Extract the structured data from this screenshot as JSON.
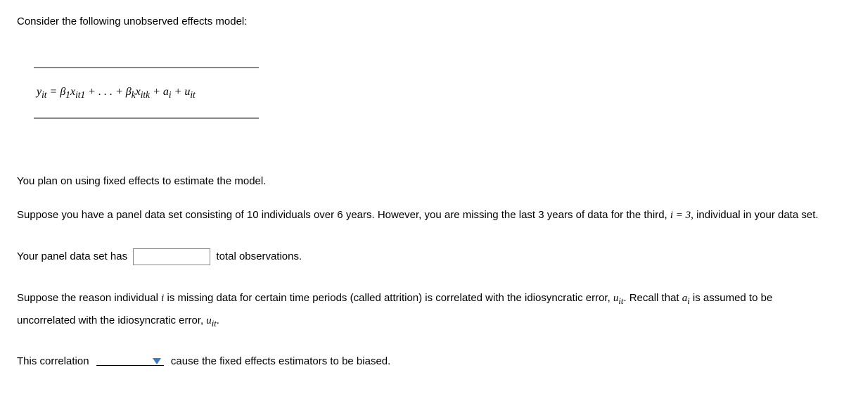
{
  "intro": "Consider the following unobserved effects model:",
  "equation": "y<sub>it</sub> = β<sub>1</sub>x<sub>it1</sub> + . . . + β<sub>k</sub>x<sub>itk</sub> + a<sub>i</sub> + u<sub>it</sub>",
  "plan": "You plan on using fixed effects to estimate the model.",
  "suppose1_a": "Suppose you have a panel data set consisting of 10 individuals over 6 years. However, you are missing the last 3 years of data for the third, ",
  "suppose1_math": "i = 3,",
  "suppose1_b": " individual in your data set.",
  "obs_a": "Your panel data set has ",
  "obs_b": " total observations.",
  "suppose2_a": "Suppose the reason individual ",
  "suppose2_math1": "i",
  "suppose2_b": " is missing data for certain time periods (called attrition) is correlated with the idiosyncratic error, ",
  "suppose2_math2": "u<sub>it</sub>",
  "suppose2_c": ". Recall that ",
  "suppose2_math3": "a<sub>i</sub>",
  "suppose2_d": " is assumed to be uncorrelated with the idiosyncratic error, ",
  "suppose2_math4": "u<sub>it</sub>",
  "suppose2_e": ".",
  "conclusion_a": "This correlation ",
  "conclusion_b": " cause the fixed effects estimators to be biased."
}
